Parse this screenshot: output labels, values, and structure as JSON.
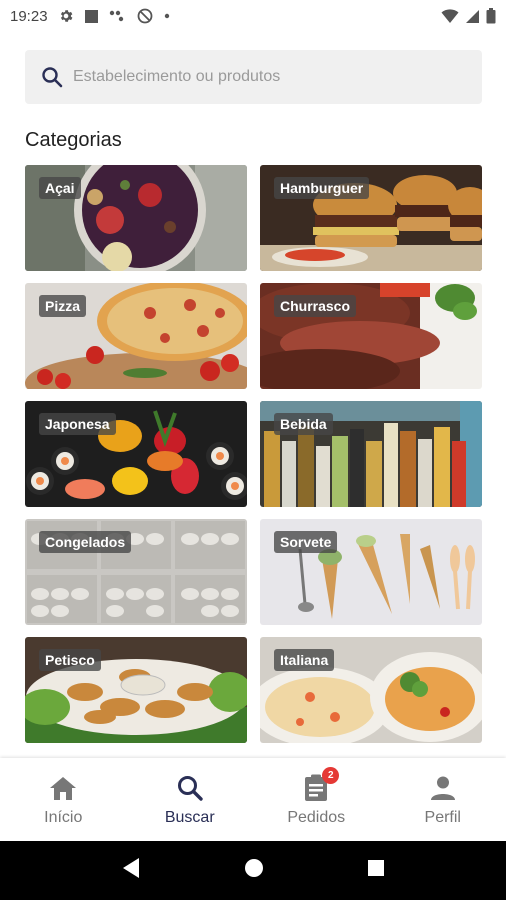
{
  "status_bar": {
    "time": "19:23",
    "icons": [
      "gear-icon",
      "square-icon",
      "dots-icon",
      "at-icon",
      "dot-icon"
    ],
    "right_icons": [
      "wifi-icon",
      "signal-icon",
      "battery-icon"
    ]
  },
  "search": {
    "placeholder": "Estabelecimento ou produtos"
  },
  "section": {
    "title": "Categorias"
  },
  "categories": [
    {
      "label": "Açai",
      "image": "acai-bowl-photo"
    },
    {
      "label": "Hamburguer",
      "image": "burgers-photo"
    },
    {
      "label": "Pizza",
      "image": "pizza-photo"
    },
    {
      "label": "Churrasco",
      "image": "steak-photo"
    },
    {
      "label": "Japonesa",
      "image": "sushi-photo"
    },
    {
      "label": "Bebida",
      "image": "bottles-photo"
    },
    {
      "label": "Congelados",
      "image": "frozen-dumplings-photo"
    },
    {
      "label": "Sorvete",
      "image": "ice-cream-cones-photo"
    },
    {
      "label": "Petisco",
      "image": "fried-snacks-photo"
    },
    {
      "label": "Italiana",
      "image": "pasta-photo"
    }
  ],
  "bottom_nav": {
    "items": [
      {
        "label": "Início",
        "icon": "home-icon"
      },
      {
        "label": "Buscar",
        "icon": "search-icon",
        "active": true
      },
      {
        "label": "Pedidos",
        "icon": "orders-icon",
        "badge": "2"
      },
      {
        "label": "Perfil",
        "icon": "person-icon"
      }
    ]
  },
  "android_nav": [
    "back-icon",
    "home-circle-icon",
    "recents-icon"
  ]
}
